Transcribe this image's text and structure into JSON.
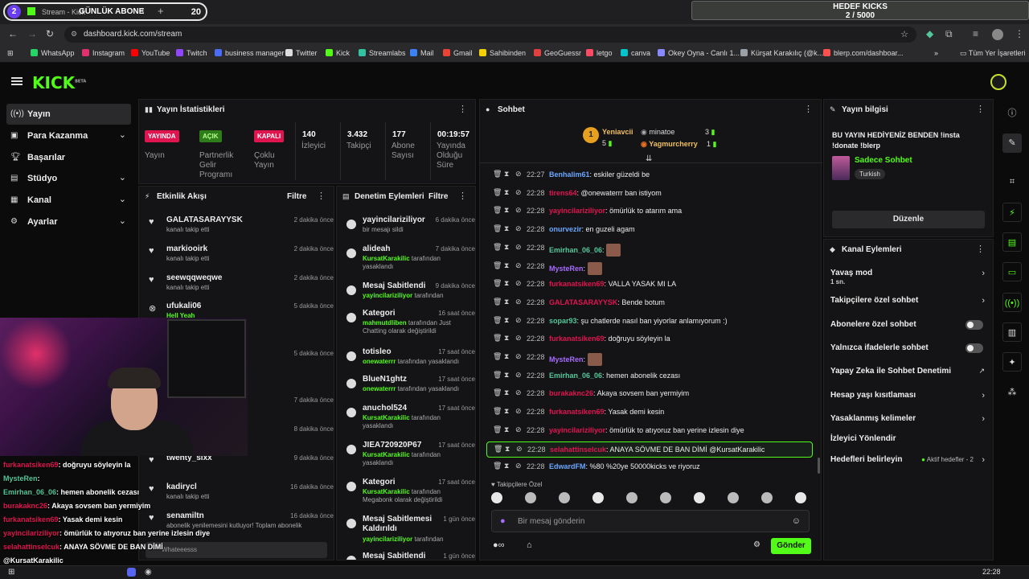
{
  "browser": {
    "tab_count": "2",
    "tab_title": "Stream - Kick",
    "overlay_tab_label": "GÜNLÜK ABONE",
    "overlay_count": "20",
    "url": "dashboard.kick.com/stream",
    "goal_title": "HEDEF KICKS",
    "goal_value": "2 / 5000",
    "bookmarks": [
      "WhatsApp",
      "Instagram",
      "YouTube",
      "Twitch",
      "business manager",
      "Twitter",
      "Kick",
      "Streamlabs",
      "Mail",
      "Gmail",
      "Sahibinden",
      "GeoGuessr",
      "letgo",
      "canva",
      "Okey Oyna - Canlı 1...",
      "Kürşat Karakılıç (@k...",
      "blerp.com/dashboar..."
    ],
    "all_bookmarks": "Tüm Yer İşaretleri",
    "bookmark_colors": [
      "#25d366",
      "#e1306c",
      "#ff0000",
      "#9146ff",
      "#4a6cf7",
      "#dddddd",
      "#53fc18",
      "#31c3a2",
      "#3b82f6",
      "#ea4335",
      "#f5d000",
      "#e04040",
      "#ff4a64",
      "#00c4cc",
      "#8888ff",
      "#9aa0a6",
      "#ff5050"
    ]
  },
  "kick": {
    "logo_text": "KICK",
    "logo_beta": "BETA",
    "colors": {
      "accent": "#53fc18",
      "live": "#e0154f",
      "panel": "#141416"
    }
  },
  "sidebar": {
    "items": [
      {
        "label": "Yayın",
        "icon": "broadcast-icon",
        "chev": ""
      },
      {
        "label": "Para Kazanma",
        "icon": "wallet-icon",
        "chev": "⌄"
      },
      {
        "label": "Başarılar",
        "icon": "trophy-icon",
        "chev": ""
      },
      {
        "label": "Stüdyo",
        "icon": "studio-icon",
        "chev": "⌄"
      },
      {
        "label": "Kanal",
        "icon": "channel-icon",
        "chev": "⌄"
      },
      {
        "label": "Ayarlar",
        "icon": "gear-icon",
        "chev": "⌄"
      }
    ]
  },
  "stats": {
    "title": "Yayın İstatistikleri",
    "items": [
      {
        "badge": "YAYINDA",
        "label": "Yayın"
      },
      {
        "badge": "AÇIK",
        "label": "Partnerlik Gelir Programı"
      },
      {
        "badge": "KAPALI",
        "label": "Çoklu Yayın"
      },
      {
        "value": "140",
        "label": "İzleyici"
      },
      {
        "value": "3.432",
        "label": "Takipçi"
      },
      {
        "value": "177",
        "label": "Abone Sayısı"
      },
      {
        "value": "00:19:57",
        "label": "Yayında Olduğu Süre"
      }
    ]
  },
  "activity": {
    "title": "Etkinlik Akışı",
    "filter": "Filtre",
    "items": [
      {
        "name": "GALATASARAYYSK",
        "sub": "kanalı takip etti",
        "time": "2 dakika önce"
      },
      {
        "name": "markiooirk",
        "sub": "kanalı takip etti",
        "time": "2 dakika önce"
      },
      {
        "name": "seewqqweqwe",
        "sub": "kanalı takip etti",
        "time": "2 dakika önce"
      },
      {
        "name": "ufukali06",
        "sub": "Hell Yeah",
        "time": "5 dakika önce"
      },
      {
        "name": "",
        "sub": "",
        "time": "5 dakika önce"
      },
      {
        "name": "",
        "sub": "",
        "time": "7 dakika önce"
      },
      {
        "name": "",
        "sub": "",
        "time": "8 dakika önce"
      },
      {
        "name": "twenty_sixx",
        "sub": "",
        "time": "9 dakika önce"
      },
      {
        "name": "kadirycl",
        "sub": "kanalı takip etti",
        "time": "16 dakika önce"
      },
      {
        "name": "senamiltn",
        "sub": "abonelik yenilemesini kutluyor! Toplam abonelik",
        "time": "16 dakika önce"
      }
    ],
    "bottom_text": "Whateeesss"
  },
  "moderation": {
    "title": "Denetim Eylemleri",
    "filter": "Filtre",
    "items": [
      {
        "name": "yayincilariziliyor",
        "time": "6 dakika önce",
        "by": "",
        "sub": "bir mesajı sildi",
        "icon": "trash-icon"
      },
      {
        "name": "alideah",
        "time": "7 dakika önce",
        "by": "KursatKarakilic",
        "sub": " tarafından yasaklandı",
        "icon": "ban-icon"
      },
      {
        "name": "Mesaj Sabitlendi",
        "time": "9 dakika önce",
        "by": "yayincilariziliyor",
        "sub": " tarafından",
        "icon": "pin-icon"
      },
      {
        "name": "Kategori",
        "time": "16 saat önce",
        "by": "mahmutdliben",
        "sub": " tarafından Just Chatting olarak değiştirildi",
        "icon": "category-icon"
      },
      {
        "name": "totisleo",
        "time": "17 saat önce",
        "by": "onewaterrr",
        "sub": " tarafından yasaklandı",
        "icon": "ban-icon"
      },
      {
        "name": "BlueN1ghtz",
        "time": "17 saat önce",
        "by": "onewaterrr",
        "sub": " tarafından yasaklandı",
        "icon": "ban-icon"
      },
      {
        "name": "anuchol524",
        "time": "17 saat önce",
        "by": "KursatKarakilic",
        "sub": " tarafından yasaklandı",
        "icon": "ban-icon"
      },
      {
        "name": "JIEA720920P67",
        "time": "17 saat önce",
        "by": "KursatKarakilic",
        "sub": " tarafından yasaklandı",
        "icon": "ban-icon"
      },
      {
        "name": "Kategori",
        "time": "17 saat önce",
        "by": "KursatKarakilic",
        "sub": " tarafından Megabonk olarak değiştirildi",
        "icon": "category-icon"
      },
      {
        "name": "Mesaj Sabitlemesi Kaldırıldı",
        "time": "1 gün önce",
        "by": "yayincilariziliyor",
        "sub": " tarafından",
        "icon": "unpin-icon"
      },
      {
        "name": "Mesaj Sabitlendi",
        "time": "1 gün önce",
        "by": "",
        "sub": "",
        "icon": "pin-icon"
      }
    ]
  },
  "chat": {
    "title": "Sohbet",
    "leaderboard": [
      {
        "rank": "1",
        "name": "Yeniavcii",
        "count": "5"
      },
      {
        "rank": "",
        "name": "minatoe",
        "count": "3"
      },
      {
        "rank": "",
        "name": "Yagmurcherry",
        "count": "1"
      }
    ],
    "messages": [
      {
        "time": "22:27",
        "user": "Benhalim61",
        "color": "#6aa7ff",
        "text": "eskiler güzeldi be",
        "emote": false
      },
      {
        "time": "22:28",
        "user": "tirens64",
        "color": "#e0154f",
        "text": "@onewaterrr ban istiyom",
        "emote": false
      },
      {
        "time": "22:28",
        "user": "yayincilariziliyor",
        "color": "#e0154f",
        "text": "ömürlük to atarım ama",
        "emote": false
      },
      {
        "time": "22:28",
        "user": "onurvezir",
        "color": "#6aa7ff",
        "text": "en guzeli agam",
        "emote": false
      },
      {
        "time": "22:28",
        "user": "Emirhan_06_06",
        "color": "#53c79a",
        "text": "",
        "emote": true
      },
      {
        "time": "22:28",
        "user": "MysteRen",
        "color": "#a86bff",
        "text": "",
        "emote": true
      },
      {
        "time": "22:28",
        "user": "furkanatsiken69",
        "color": "#e0154f",
        "text": "VALLA YASAK MI LA",
        "emote": false
      },
      {
        "time": "22:28",
        "user": "GALATASARAYYSK",
        "color": "#e0154f",
        "text": "Bende botum",
        "emote": false
      },
      {
        "time": "22:28",
        "user": "sopar93",
        "color": "#53c79a",
        "text": "şu chatlerde nasıl ban yiyorlar anlamıyorum :)",
        "emote": false
      },
      {
        "time": "22:28",
        "user": "furkanatsiken69",
        "color": "#e0154f",
        "text": "doğruyu söyleyin la",
        "emote": false
      },
      {
        "time": "22:28",
        "user": "MysteRen",
        "color": "#a86bff",
        "text": "",
        "emote": true
      },
      {
        "time": "22:28",
        "user": "Emirhan_06_06",
        "color": "#53c79a",
        "text": "hemen abonelik cezası",
        "emote": false
      },
      {
        "time": "22:28",
        "user": "burakaknc26",
        "color": "#e0154f",
        "text": "Akaya sovsem ban yermiyim",
        "emote": false
      },
      {
        "time": "22:28",
        "user": "furkanatsiken69",
        "color": "#e0154f",
        "text": "Yasak demi kesin",
        "emote": false
      },
      {
        "time": "22:28",
        "user": "yayincilariziliyor",
        "color": "#e0154f",
        "text": "ömürlük to atıyoruz ban yerine izlesin diye",
        "emote": false
      },
      {
        "time": "22:28",
        "user": "selahattinselcuk",
        "color": "#e0154f",
        "text": "ANAYA SÖVME DE BAN DİMİ @KursatKarakilic",
        "emote": false
      },
      {
        "time": "22:28",
        "user": "EdwardFM",
        "color": "#6aa7ff",
        "text": "%80 %20ye 50000kicks ve riyoruz",
        "emote": false
      }
    ],
    "followers_only": "Takipçilere Özel",
    "input_placeholder": "Bir mesaj gönderin",
    "send_label": "Gönder"
  },
  "stream_info": {
    "title": "Yayın bilgisi",
    "text": "BU YAYIN HEDİYENİZ BENDEN !insta !donate !blerp",
    "category": "Sadece Sohbet",
    "language": "Turkish",
    "edit_label": "Düzenle"
  },
  "channel_actions": {
    "title": "Kanal Eylemleri",
    "items": [
      {
        "label": "Yavaş mod",
        "sub": "1 sn.",
        "control": "arrow"
      },
      {
        "label": "Takipçilere özel sohbet",
        "sub": "",
        "control": "arrow"
      },
      {
        "label": "Abonelere özel sohbet",
        "sub": "",
        "control": "toggle"
      },
      {
        "label": "Yalnızca ifadelerle sohbet",
        "sub": "",
        "control": "toggle"
      },
      {
        "label": "Yapay Zeka ile Sohbet Denetimi",
        "sub": "",
        "control": "ext"
      },
      {
        "label": "Hesap yaşı kısıtlaması",
        "sub": "",
        "control": "arrow"
      },
      {
        "label": "Yasaklanmış kelimeler",
        "sub": "",
        "control": "arrow"
      },
      {
        "label": "İzleyici Yönlendir",
        "sub": "",
        "control": "none"
      },
      {
        "label": "Hedefleri belirleyin",
        "sub": "",
        "control": "goal"
      }
    ],
    "goal_status": "Aktif hedefler - 2"
  },
  "overlay_chat": [
    {
      "user": "furkanatsiken69",
      "color": "#e0154f",
      "text": ": doğruyu söyleyin la"
    },
    {
      "user": "MysteRen",
      "color": "#53c79a",
      "text": ": "
    },
    {
      "user": "Emirhan_06_06",
      "color": "#53c79a",
      "text": ": hemen abonelik cezası"
    },
    {
      "user": "burakaknc26",
      "color": "#e0154f",
      "text": ": Akaya sovsem ban yermiyim"
    },
    {
      "user": "furkanatsiken69",
      "color": "#e0154f",
      "text": ": Yasak demi kesin"
    },
    {
      "user": "yayincilariziliyor",
      "color": "#e0154f",
      "text": ": ömürlük to atıyoruz ban yerine izlesin diye"
    },
    {
      "user": "selahattinselcuk",
      "color": "#e0154f",
      "text": ": ANAYA SÖVME DE BAN DİMİ"
    },
    {
      "user": "",
      "color": "#fff",
      "text": "@KursatKarakilic"
    },
    {
      "user": "",
      "color": "#fff",
      "text": "%80 %20ye 50000kicks ve riyoruz"
    }
  ],
  "taskbar": {
    "time": "22:28"
  }
}
